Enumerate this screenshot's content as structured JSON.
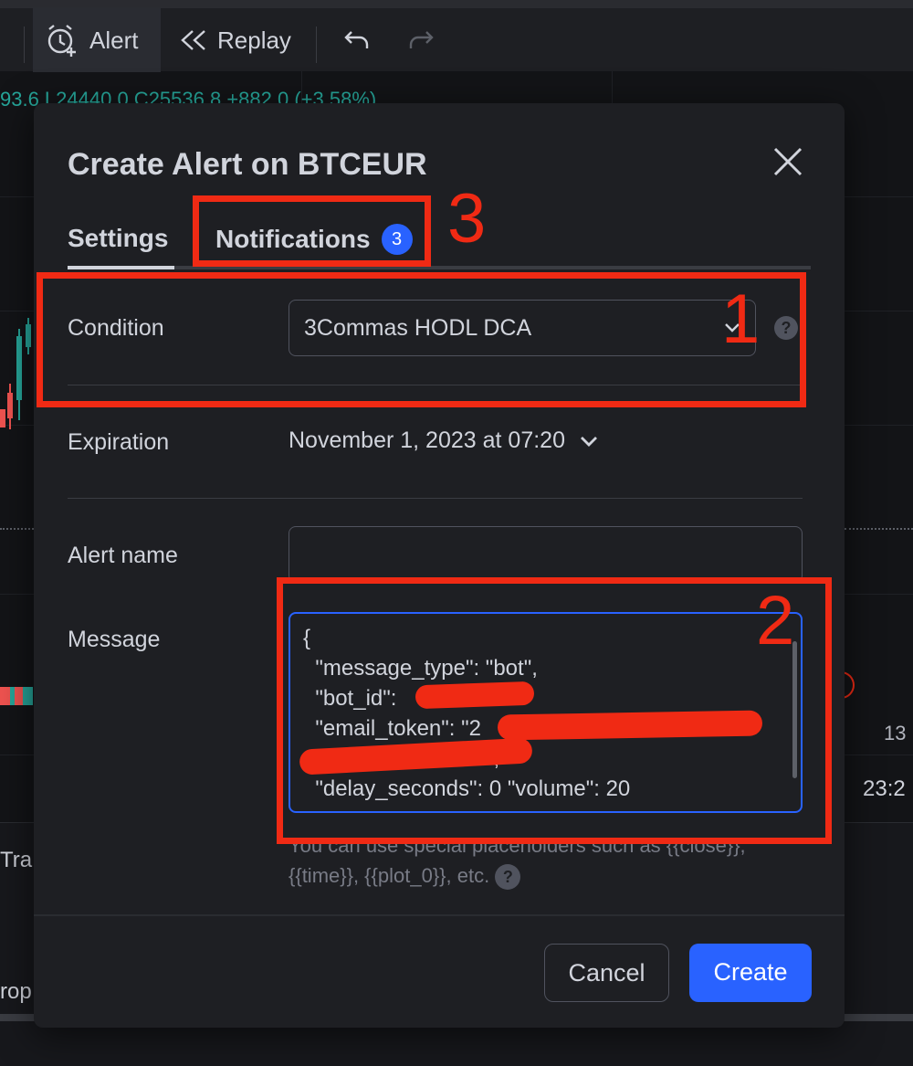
{
  "toolbar": {
    "alert_label": "Alert",
    "replay_label": "Replay",
    "alert_icon": "alarm-clock-plus-icon",
    "replay_icon": "rewind-icon",
    "undo_icon": "undo-icon",
    "redo_icon": "redo-icon"
  },
  "chart_bg": {
    "ohlc_text": "93.6 L24440.0 C25536.8 +882.0 (+3.58%)",
    "axis_right_1": "13",
    "axis_right_2": "23:2",
    "bottom_text_1": "Tra",
    "bottom_text_2": "rop"
  },
  "dialog": {
    "title": "Create Alert on BTCEUR",
    "tabs": [
      {
        "label": "Settings"
      },
      {
        "label": "Notifications",
        "badge": "3"
      }
    ],
    "condition": {
      "label": "Condition",
      "value": "3Commas HODL DCA"
    },
    "expiration": {
      "label": "Expiration",
      "value": "November 1, 2023 at 07:20"
    },
    "alert_name": {
      "label": "Alert name",
      "value": ""
    },
    "message": {
      "label": "Message",
      "lines": [
        "{",
        "  \"message_type\": \"bot\",",
        "  \"bot_id\": ",
        "  \"email_token\": \"2",
        "                              \",",
        "  \"delay_seconds\": 0 \"volume\": 20"
      ]
    },
    "hint": "You can use special placeholders such as {{close}}, {{time}}, {{plot_0}}, etc.",
    "cancel_label": "Cancel",
    "create_label": "Create"
  },
  "annotations": {
    "one": "1",
    "two": "2",
    "three": "3",
    "color": "#f02a14"
  },
  "colors": {
    "accent": "#2962ff",
    "dialog_bg": "#1e1f23",
    "text": "#d1d4dc",
    "muted": "#787b86"
  }
}
